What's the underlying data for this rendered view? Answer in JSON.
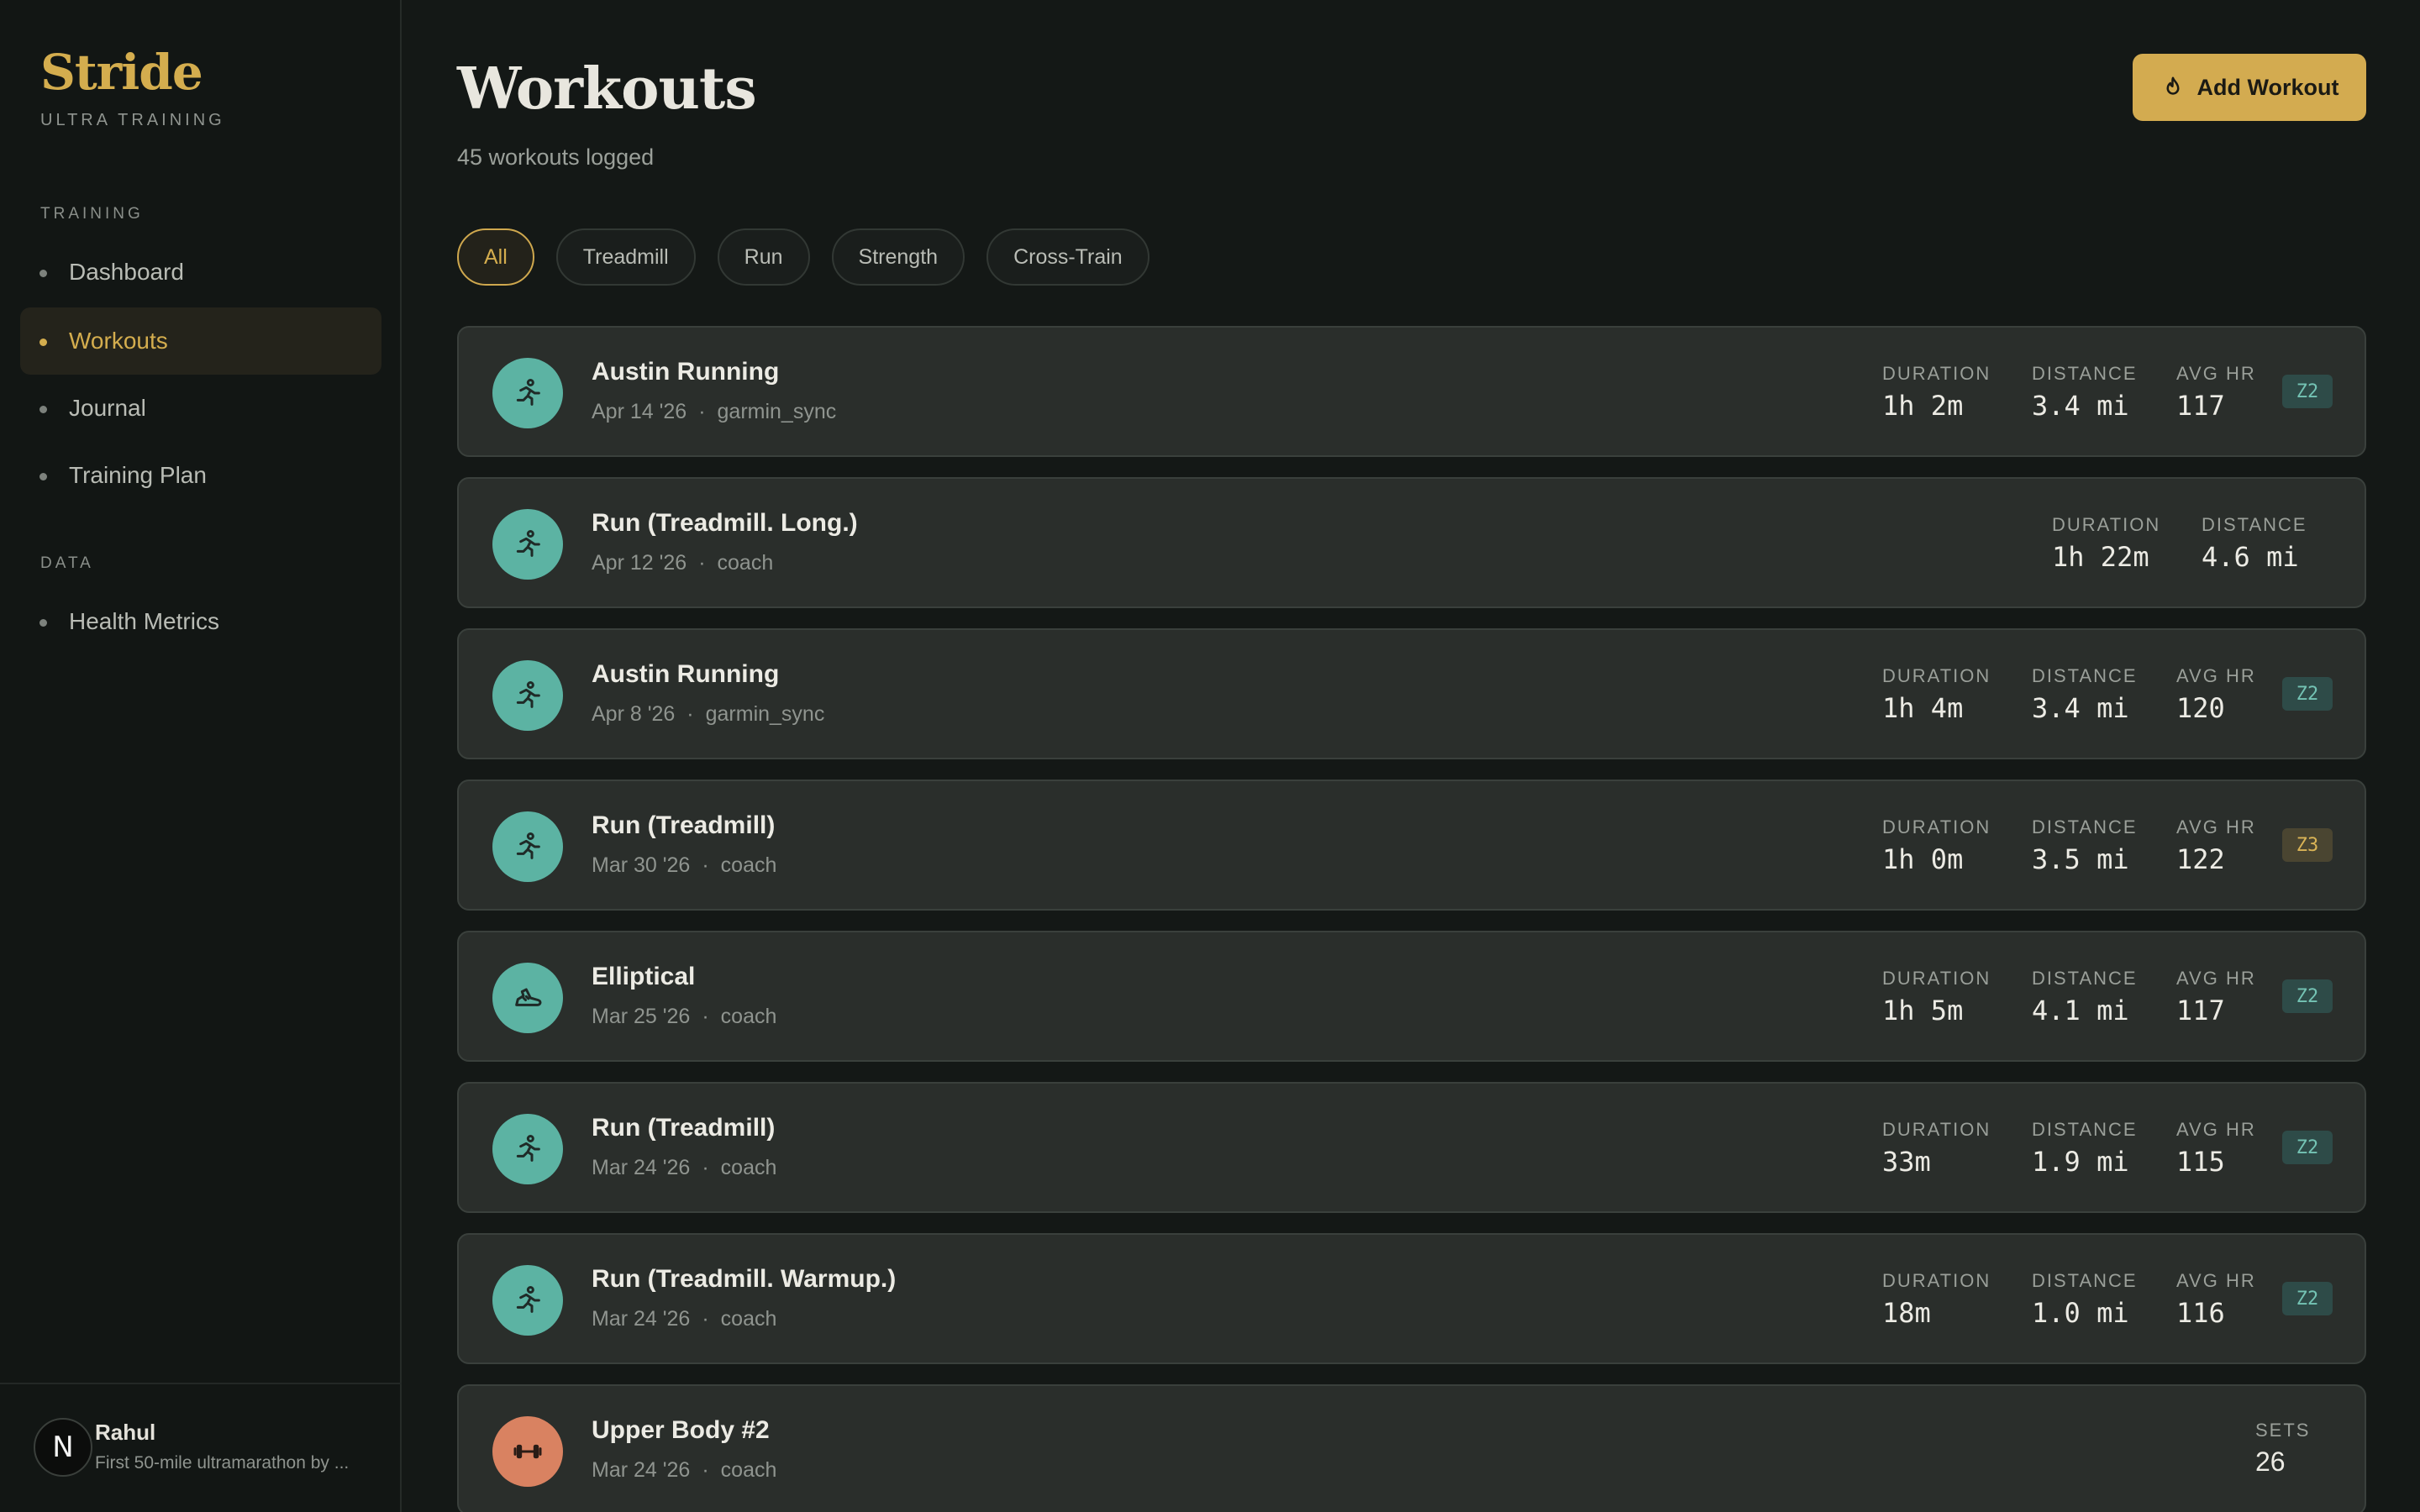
{
  "brand": {
    "name": "Stride",
    "tagline": "ULTRA TRAINING"
  },
  "sidebar": {
    "sections": [
      {
        "label": "TRAINING",
        "items": [
          {
            "label": "Dashboard",
            "active": false
          },
          {
            "label": "Workouts",
            "active": true
          },
          {
            "label": "Journal",
            "active": false
          },
          {
            "label": "Training Plan",
            "active": false
          }
        ]
      },
      {
        "label": "DATA",
        "items": [
          {
            "label": "Health Metrics",
            "active": false
          }
        ]
      }
    ]
  },
  "user": {
    "initial": "N",
    "name": "Rahul",
    "goal": "First 50-mile ultramarathon by ..."
  },
  "header": {
    "title": "Workouts",
    "subtitle": "45 workouts logged",
    "add_label": "Add Workout"
  },
  "filters": [
    {
      "label": "All",
      "active": true
    },
    {
      "label": "Treadmill",
      "active": false
    },
    {
      "label": "Run",
      "active": false
    },
    {
      "label": "Strength",
      "active": false
    },
    {
      "label": "Cross-Train",
      "active": false
    }
  ],
  "workouts": [
    {
      "title": "Austin Running",
      "date": "Apr 14 '26",
      "source": "garmin_sync",
      "icon": "runner-icon",
      "duration_label": "DURATION",
      "duration": "1h 2m",
      "distance_label": "DISTANCE",
      "distance": "3.4 mi",
      "hr_label": "AVG HR",
      "avg_hr": "117",
      "zone": "Z2"
    },
    {
      "title": "Run (Treadmill. Long.)",
      "date": "Apr 12 '26",
      "source": "coach",
      "icon": "runner-icon",
      "duration_label": "DURATION",
      "duration": "1h 22m",
      "distance_label": "DISTANCE",
      "distance": "4.6 mi"
    },
    {
      "title": "Austin Running",
      "date": "Apr 8 '26",
      "source": "garmin_sync",
      "icon": "runner-icon",
      "duration_label": "DURATION",
      "duration": "1h 4m",
      "distance_label": "DISTANCE",
      "distance": "3.4 mi",
      "hr_label": "AVG HR",
      "avg_hr": "120",
      "zone": "Z2"
    },
    {
      "title": "Run (Treadmill)",
      "date": "Mar 30 '26",
      "source": "coach",
      "icon": "runner-icon",
      "duration_label": "DURATION",
      "duration": "1h 0m",
      "distance_label": "DISTANCE",
      "distance": "3.5 mi",
      "hr_label": "AVG HR",
      "avg_hr": "122",
      "zone": "Z3"
    },
    {
      "title": "Elliptical",
      "date": "Mar 25 '26",
      "source": "coach",
      "icon": "shoe-icon",
      "duration_label": "DURATION",
      "duration": "1h 5m",
      "distance_label": "DISTANCE",
      "distance": "4.1 mi",
      "hr_label": "AVG HR",
      "avg_hr": "117",
      "zone": "Z2"
    },
    {
      "title": "Run (Treadmill)",
      "date": "Mar 24 '26",
      "source": "coach",
      "icon": "runner-icon",
      "duration_label": "DURATION",
      "duration": "33m",
      "distance_label": "DISTANCE",
      "distance": "1.9 mi",
      "hr_label": "AVG HR",
      "avg_hr": "115",
      "zone": "Z2"
    },
    {
      "title": "Run (Treadmill. Warmup.)",
      "date": "Mar 24 '26",
      "source": "coach",
      "icon": "runner-icon",
      "duration_label": "DURATION",
      "duration": "18m",
      "distance_label": "DISTANCE",
      "distance": "1.0 mi",
      "hr_label": "AVG HR",
      "avg_hr": "116",
      "zone": "Z2"
    },
    {
      "title": "Upper Body #2",
      "date": "Mar 24 '26",
      "source": "coach",
      "icon": "dumbbell-icon",
      "sets_label": "SETS",
      "sets": "26"
    }
  ],
  "colors": {
    "accent": "#d4ad4e",
    "teal": "#5cb3a3",
    "strength": "#d98261",
    "background": "#141816"
  }
}
